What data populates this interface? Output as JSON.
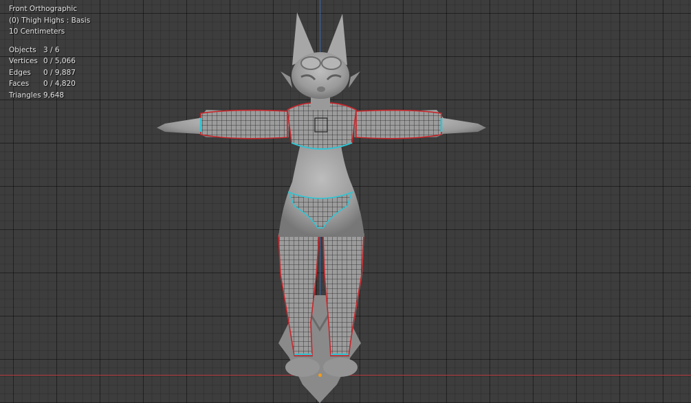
{
  "viewport": {
    "view_name": "Front Orthographic",
    "active_object": "(0) Thigh Highs : Basis",
    "grid_scale": "10 Centimeters"
  },
  "stats": [
    {
      "label": "Objects",
      "value": "3 / 6"
    },
    {
      "label": "Vertices",
      "value": "0 / 5,066"
    },
    {
      "label": "Edges",
      "value": "0 / 9,887"
    },
    {
      "label": "Faces",
      "value": "0 / 4,820"
    },
    {
      "label": "Triangles",
      "value": "9,648"
    }
  ],
  "colors": {
    "background": "#3d3d3d",
    "x_axis": "#b8363f",
    "z_axis": "#3e6aad",
    "origin": "#f29b1a",
    "selection_outline": "#c8252a",
    "selected_edge": "#2ec6d6",
    "model_grey": "#a3a3a3"
  }
}
